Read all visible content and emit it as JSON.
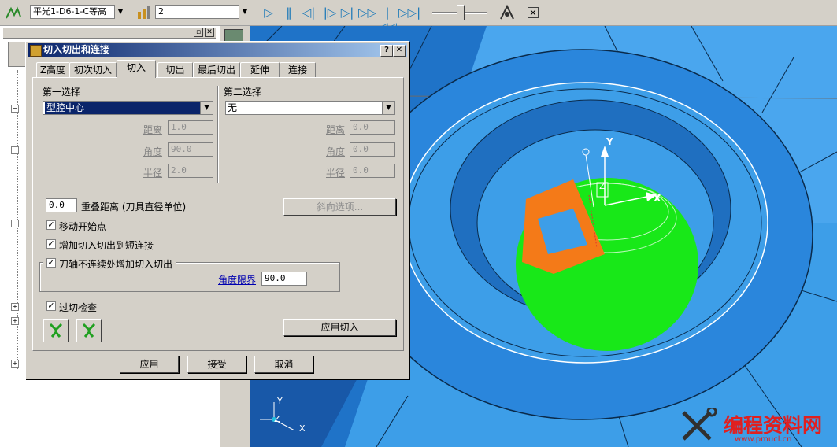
{
  "toolbar": {
    "operation_combo": "平光1-D6-1-C等高",
    "tool_combo": "2",
    "controls": [
      "play",
      "pause",
      "step-back",
      "step-forward-end",
      "forward",
      "rewind-to-start",
      "forward-to-end"
    ]
  },
  "dialog": {
    "title": "切入切出和连接",
    "help_label": "?",
    "close_label": "✕",
    "tabs": [
      "Z高度",
      "初次切入",
      "切入",
      "切出",
      "最后切出",
      "延伸",
      "连接"
    ],
    "active_tab": "切入",
    "first_choice": {
      "label": "第一选择",
      "value": "型腔中心",
      "distance_label": "距离",
      "distance": "1.0",
      "angle_label": "角度",
      "angle": "90.0",
      "radius_label": "半径",
      "radius": "2.0"
    },
    "second_choice": {
      "label": "第二选择",
      "value": "无",
      "distance_label": "距离",
      "distance": "0.0",
      "angle_label": "角度",
      "angle": "0.0",
      "radius_label": "半径",
      "radius": "0.0"
    },
    "overlap": {
      "value": "0.0",
      "label": "重叠距离 (刀具直径单位)"
    },
    "ramp_options_label": "斜向选项...",
    "checkboxes": {
      "move_start": "移动开始点",
      "add_short_link": "增加切入切出到短连接",
      "axis_discontinuity": "刀轴不连续处增加切入切出",
      "gouge_check": "过切检查"
    },
    "angle_limit": {
      "label": "角度限界",
      "value": "90.0"
    },
    "apply_leadin_label": "应用切入",
    "buttons": {
      "apply": "应用",
      "accept": "接受",
      "cancel": "取消"
    }
  },
  "viewport": {
    "axis_y": "Y",
    "axis_x": "X",
    "axis_z": "Z",
    "corner_y": "Y",
    "corner_z": "Z",
    "corner_x": "X"
  },
  "watermark": {
    "title": "编程资料网",
    "url": "www.pmucl.cn"
  },
  "colors": {
    "surface_blue": "#3d9ee8",
    "toolpath_green": "#18e818",
    "tool_orange": "#f47a18",
    "titlebar": "#0a246a",
    "watermark_red": "#e02020"
  }
}
